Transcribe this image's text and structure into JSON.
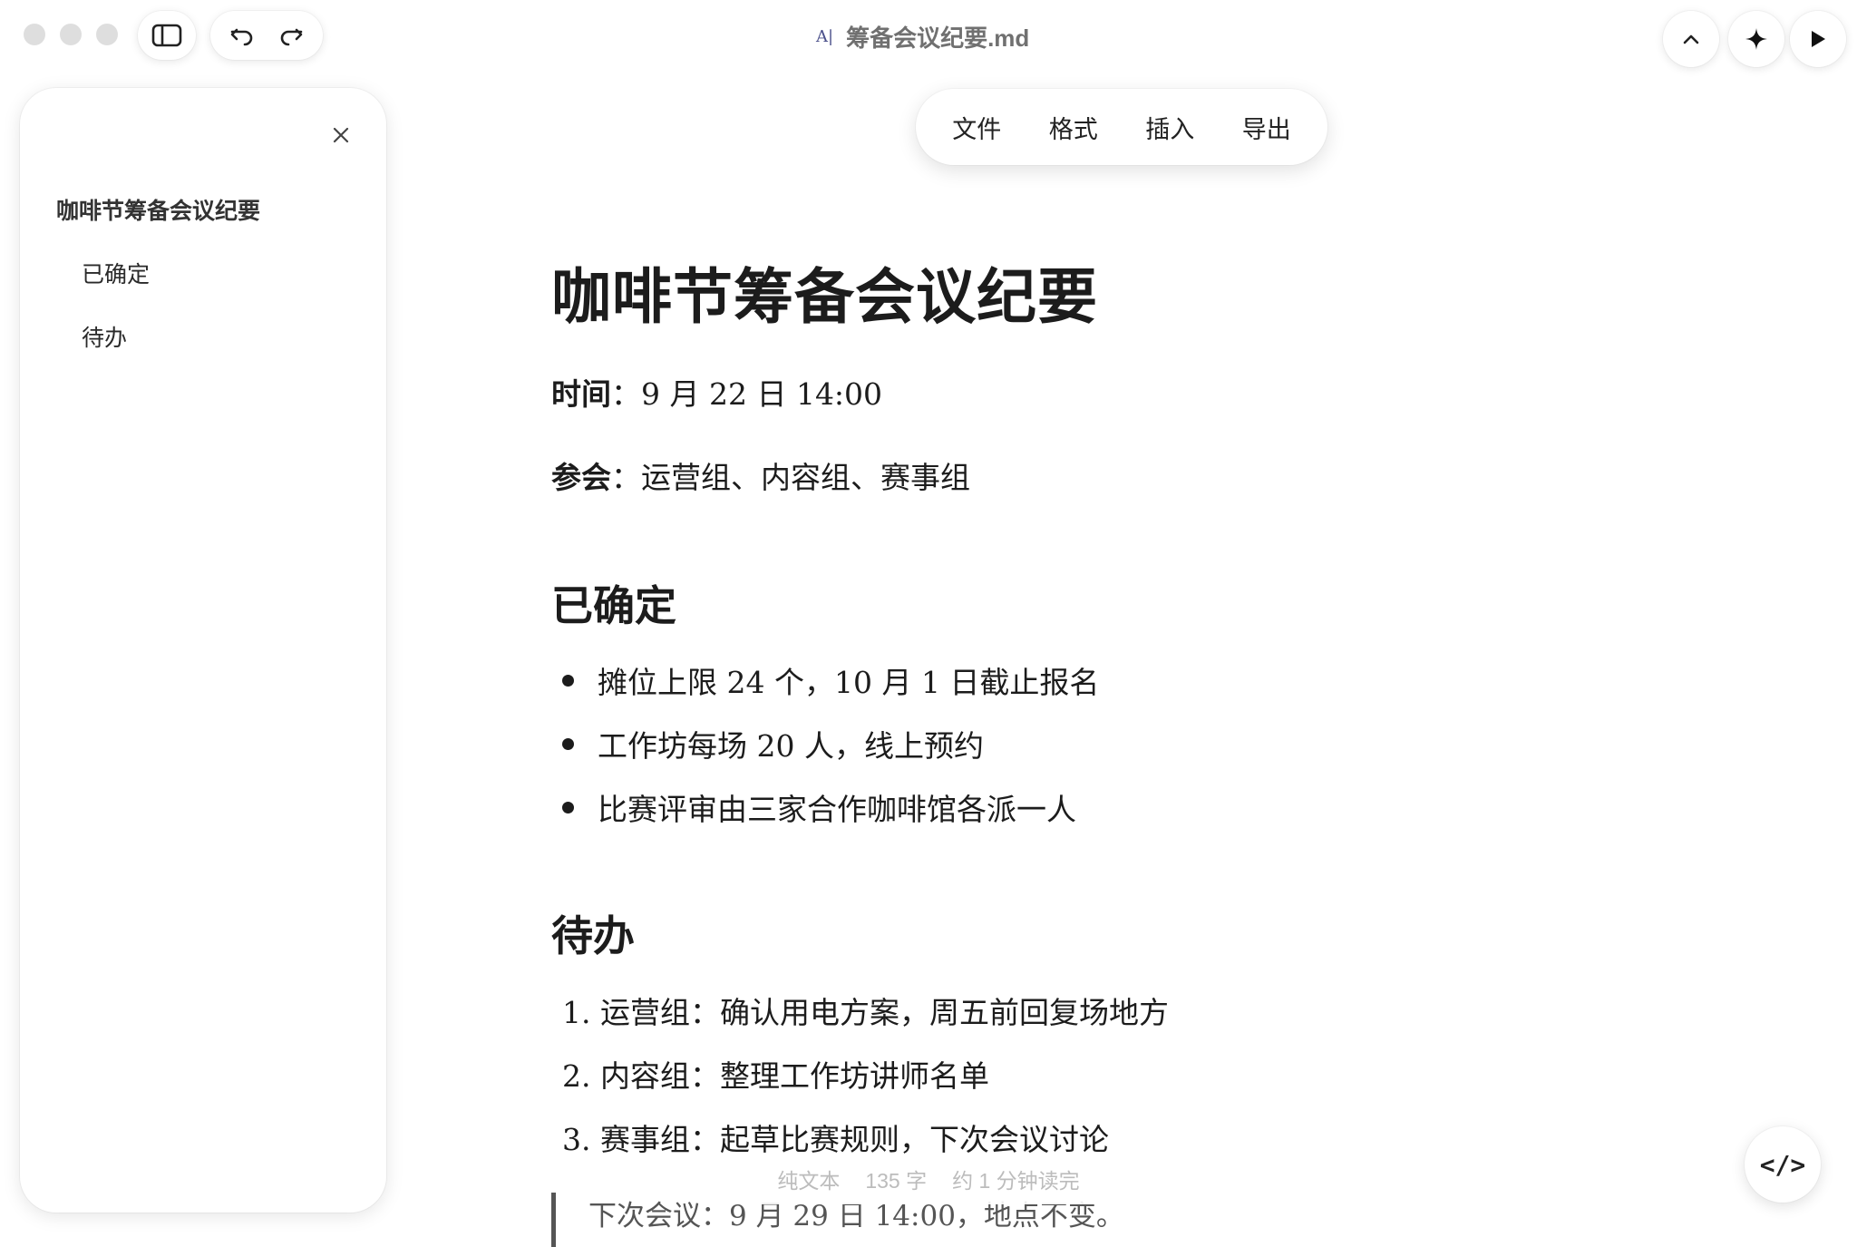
{
  "window": {
    "title": "筹备会议纪要.md",
    "file_type_badge": "A|"
  },
  "toolbar": {
    "sidebar_toggle_icon": "sidebar-icon",
    "undo_icon": "undo-icon",
    "redo_icon": "redo-icon",
    "collapse_icon": "chevron-up-icon",
    "ai_icon": "sparkle-icon",
    "play_icon": "play-icon"
  },
  "sidebar": {
    "close_icon": "close-icon",
    "toc": [
      {
        "label": "咖啡节筹备会议纪要",
        "level": 1
      },
      {
        "label": "已确定",
        "level": 2
      },
      {
        "label": "待办",
        "level": 2
      }
    ]
  },
  "menu": {
    "items": [
      "文件",
      "格式",
      "插入",
      "导出"
    ]
  },
  "document": {
    "title": "咖啡节筹备会议纪要",
    "time_label": "时间",
    "time_value": "：9 月 22 日 14:00",
    "attendees_label": "参会",
    "attendees_value": "：运营组、内容组、赛事组",
    "section1_heading": "已确定",
    "section1_items": [
      "摊位上限 24 个，10 月 1 日截止报名",
      "工作坊每场 20 人，线上预约",
      "比赛评审由三家合作咖啡馆各派一人"
    ],
    "section2_heading": "待办",
    "section2_items": [
      "1. 运营组：确认用电方案，周五前回复场地方",
      "2. 内容组：整理工作坊讲师名单",
      "3. 赛事组：起草比赛规则，下次会议讨论"
    ],
    "quote": "下次会议：9 月 29 日 14:00，地点不变。"
  },
  "status_bar": {
    "mode": "纯文本",
    "word_count": "135 字",
    "read_time": "约 1 分钟读完"
  },
  "code_toggle": {
    "label": "</>"
  }
}
